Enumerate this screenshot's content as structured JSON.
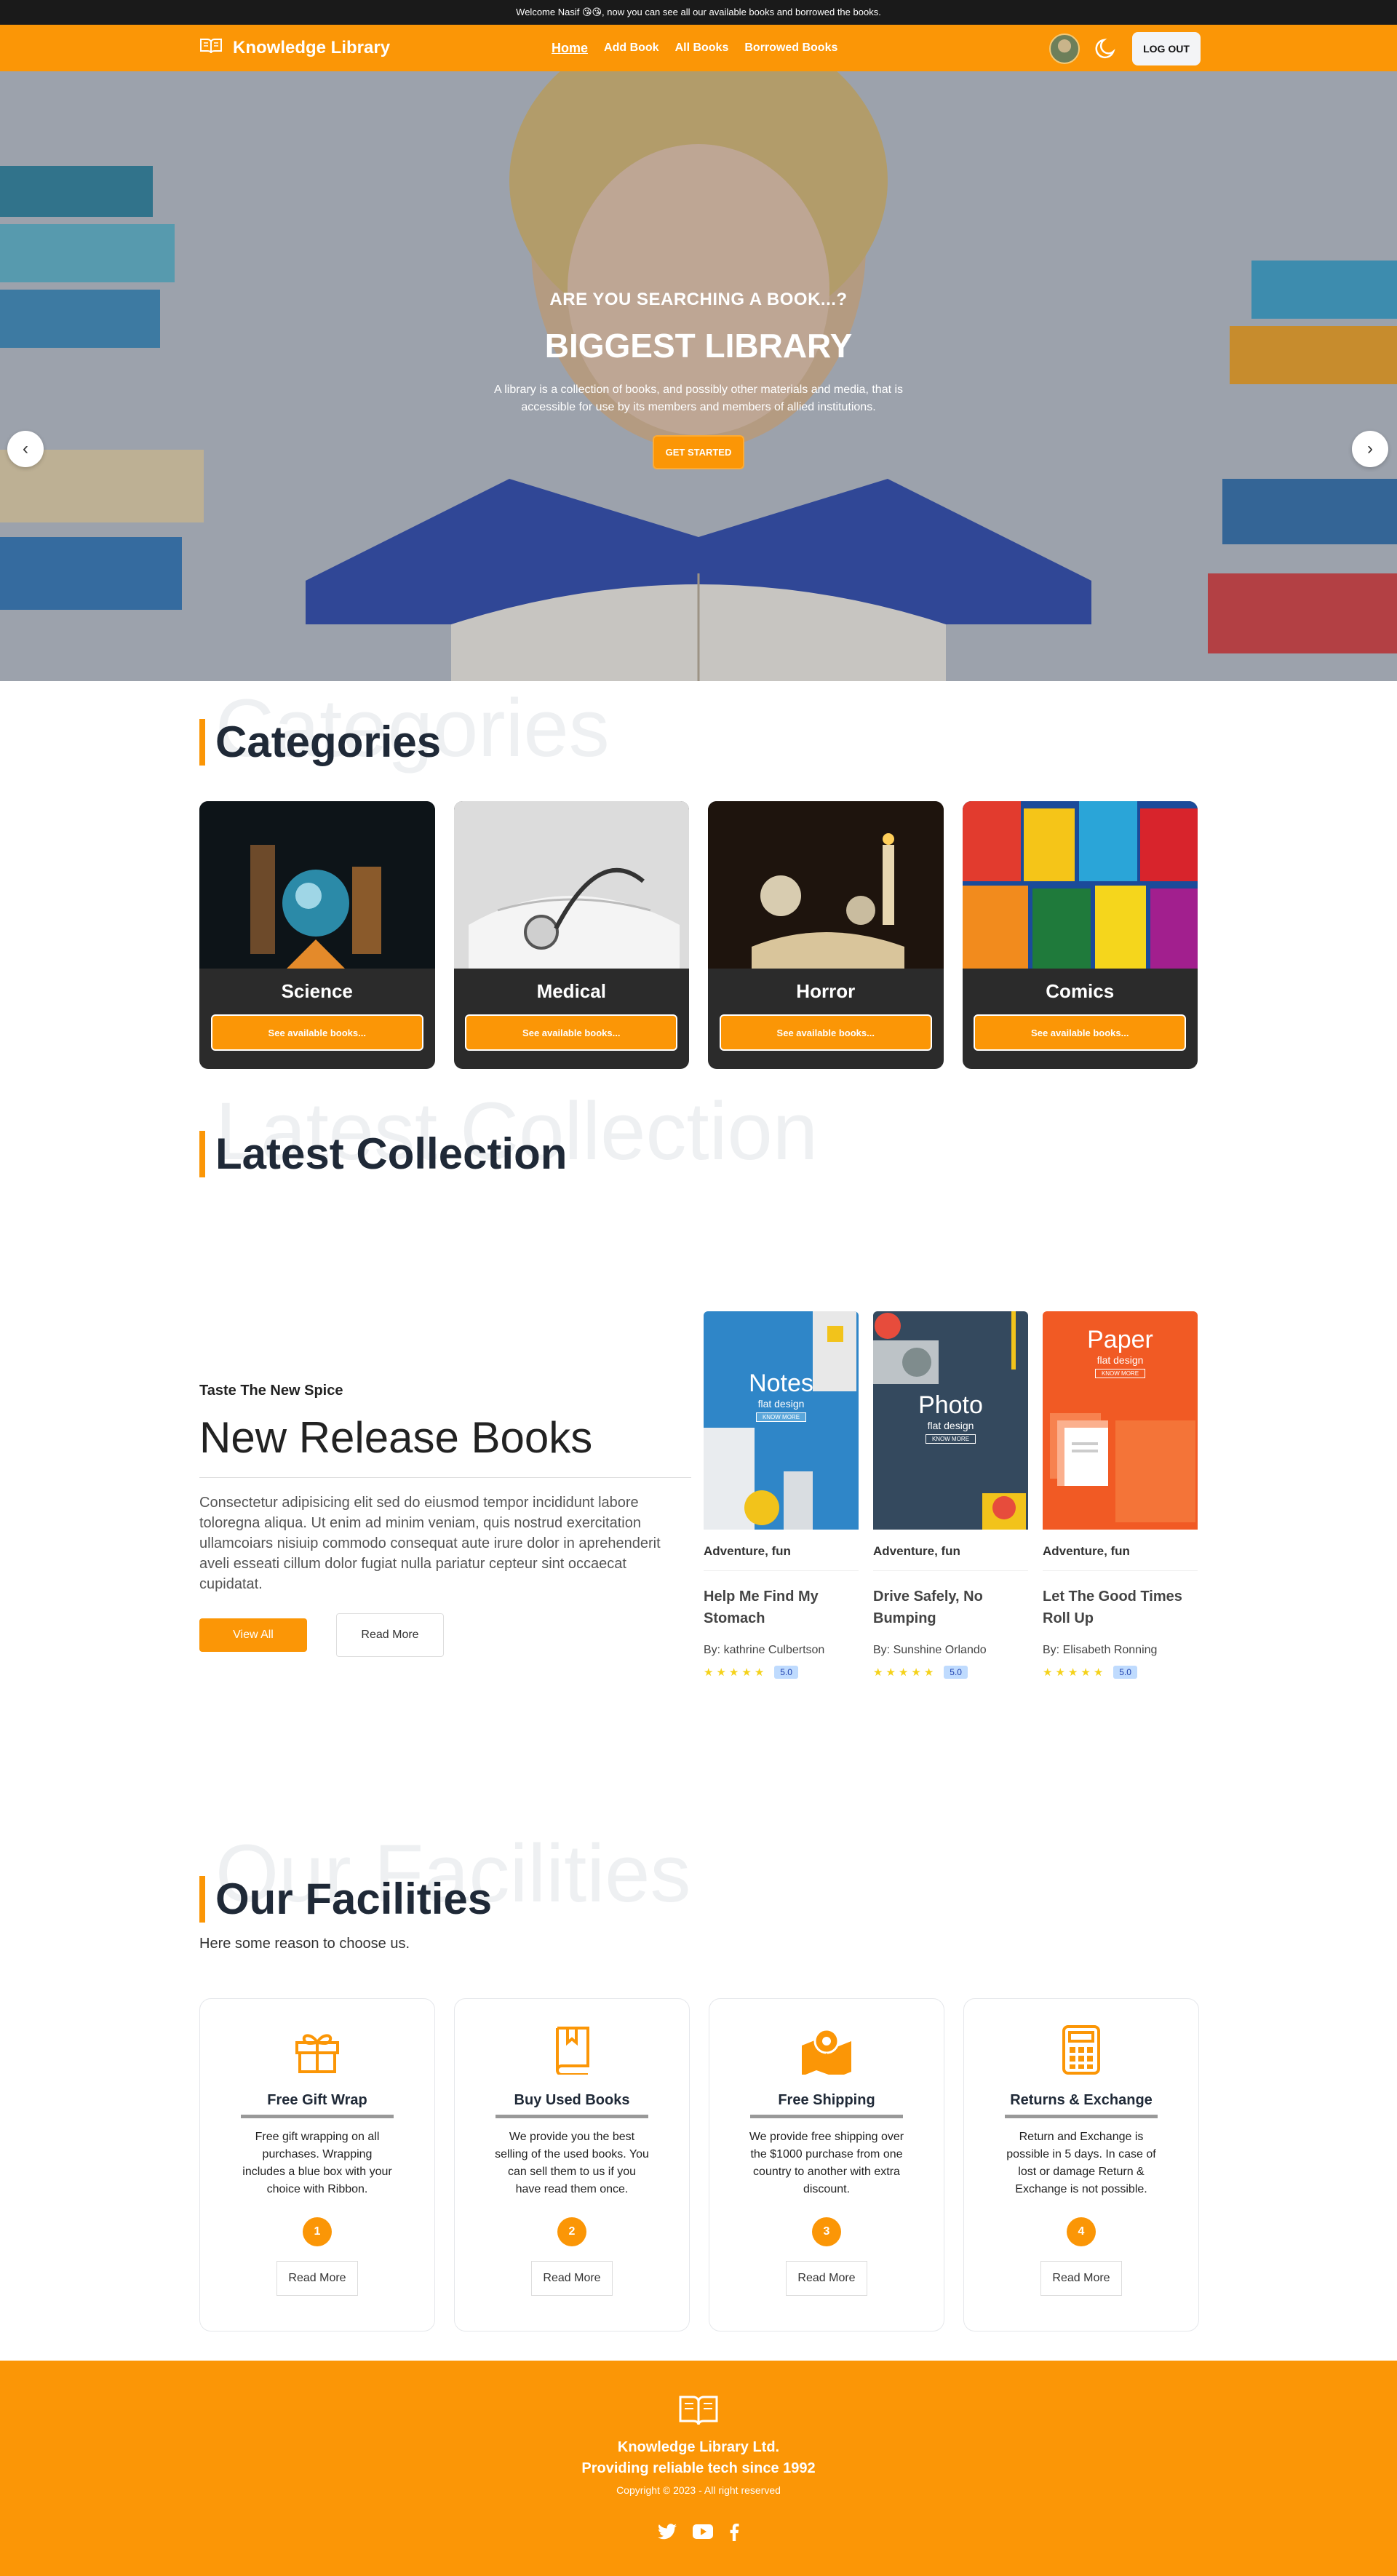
{
  "topbar": {
    "message": "Welcome Nasif 😘😘, now you can see all our available books and borrowed the books."
  },
  "nav": {
    "brand": "Knowledge Library",
    "links": [
      {
        "label": "Home"
      },
      {
        "label": "Add Book"
      },
      {
        "label": "All Books"
      },
      {
        "label": "Borrowed Books"
      }
    ],
    "logout": "LOG OUT"
  },
  "hero": {
    "kicker": "ARE YOU SEARCHING A BOOK...?",
    "title": "BIGGEST LIBRARY",
    "description": "A library is a collection of books, and possibly other materials and media, that is accessible for use by its members and members of allied institutions.",
    "cta": "GET STARTED",
    "prev": "‹",
    "next": "›"
  },
  "categories": {
    "ghost": "Categories",
    "title": "Categories",
    "items": [
      {
        "name": "Science",
        "button": "See available books..."
      },
      {
        "name": "Medical",
        "button": "See available books..."
      },
      {
        "name": "Horror",
        "button": "See available books..."
      },
      {
        "name": "Comics",
        "button": "See available books..."
      }
    ]
  },
  "latest": {
    "ghost": "Latest Collection",
    "title": "Latest Collection",
    "subtitle": "Taste The New Spice",
    "heading": "New Release Books",
    "description": "Consectetur adipisicing elit sed do eiusmod tempor incididunt labore toloregna aliqua. Ut enim ad minim veniam, quis nostrud exercitation ullamcoiars nisiuip commodo consequat aute irure dolor in aprehenderit aveli esseati cillum dolor fugiat nulla pariatur cepteur sint occaecat cupidatat.",
    "view_all": "View All",
    "read_more": "Read More",
    "books": [
      {
        "cover_title": "Notes",
        "cover_sub": "flat design",
        "cover_btn": "KNOW MORE",
        "genre": "Adventure, fun",
        "title": "Help Me Find My Stomach",
        "author": "By: kathrine Culbertson",
        "rating": "5.0",
        "stars": 5,
        "color": "#2f86c8"
      },
      {
        "cover_title": "Photo",
        "cover_sub": "flat design",
        "cover_btn": "KNOW MORE",
        "genre": "Adventure, fun",
        "title": "Drive Safely, No Bumping",
        "author": "By: Sunshine Orlando",
        "rating": "5.0",
        "stars": 5,
        "color": "#34495e"
      },
      {
        "cover_title": "Paper",
        "cover_sub": "flat design",
        "cover_btn": "KNOW MORE",
        "genre": "Adventure, fun",
        "title": "Let The Good Times Roll Up",
        "author": "By: Elisabeth Ronning",
        "rating": "5.0",
        "stars": 5,
        "color": "#f15a24"
      }
    ]
  },
  "facilities": {
    "ghost": "Our Facilities",
    "title": "Our Facilities",
    "subtitle": "Here some reason to choose us.",
    "items": [
      {
        "title": "Free Gift Wrap",
        "text": "Free gift wrapping on all purchases. Wrapping includes a blue box with your choice with Ribbon.",
        "num": "1",
        "button": "Read More",
        "icon": "gift-icon"
      },
      {
        "title": "Buy Used Books",
        "text": "We provide you the best selling of the used books. You can sell them to us if you have read them once.",
        "num": "2",
        "button": "Read More",
        "icon": "book-icon"
      },
      {
        "title": "Free Shipping",
        "text": "We provide free shipping over the $1000 purchase from one country to another with extra discount.",
        "num": "3",
        "button": "Read More",
        "icon": "map-pin-icon"
      },
      {
        "title": "Returns & Exchange",
        "text": "Return and Exchange is possible in 5 days. In case of lost or damage Return & Exchange is not possible.",
        "num": "4",
        "button": "Read More",
        "icon": "calculator-icon"
      }
    ]
  },
  "footer": {
    "company": "Knowledge Library Ltd.",
    "tagline": "Providing reliable tech since 1992",
    "copyright": "Copyright © 2023 - All right reserved"
  },
  "colors": {
    "accent": "#fb9606",
    "dark": "#2b2b2b"
  }
}
